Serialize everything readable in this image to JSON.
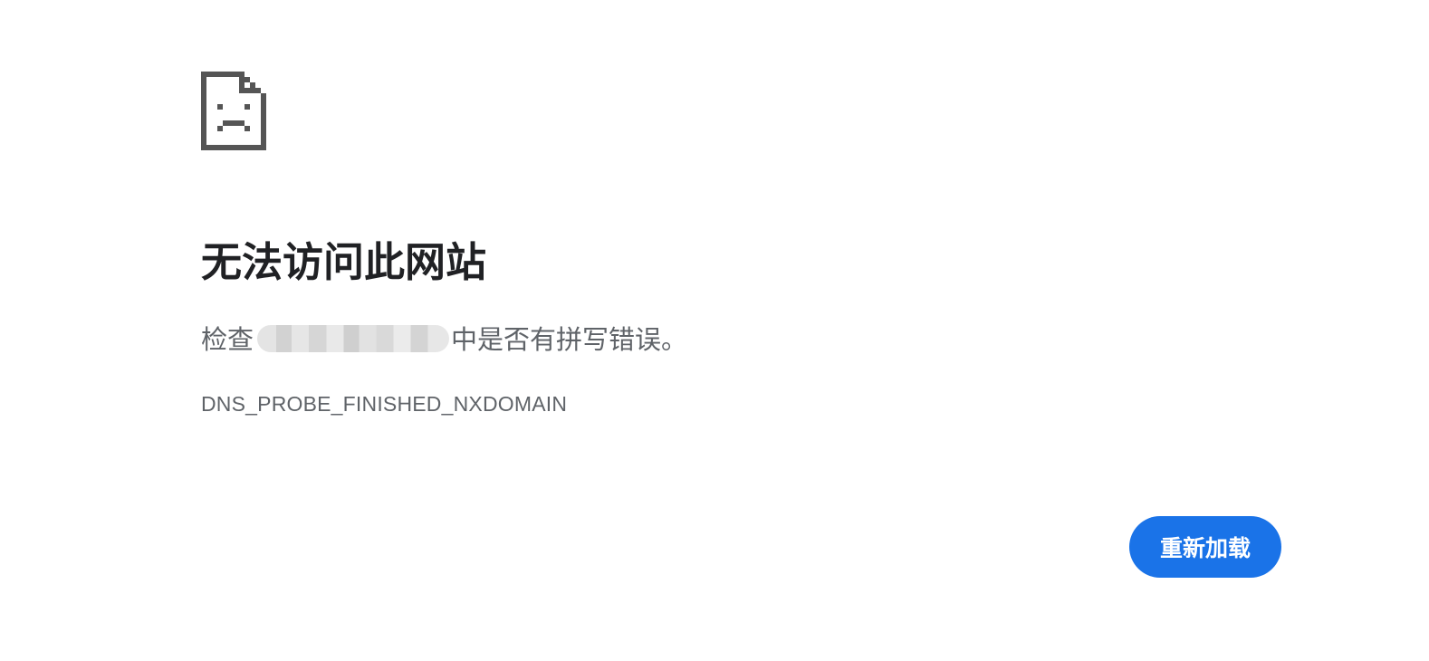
{
  "error": {
    "icon": "sad-page-icon",
    "title": "无法访问此网站",
    "message_prefix": "检查",
    "message_suffix": "中是否有拼写错误。",
    "error_code": "DNS_PROBE_FINISHED_NXDOMAIN"
  },
  "actions": {
    "reload_label": "重新加载"
  },
  "colors": {
    "title": "#202124",
    "body_text": "#5f6368",
    "icon": "#555555",
    "button_background": "#1a73e8",
    "button_text": "#ffffff"
  }
}
